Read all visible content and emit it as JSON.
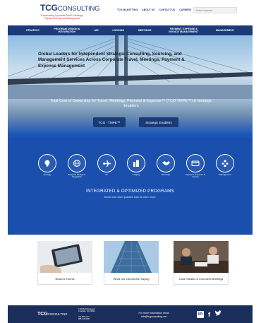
{
  "header": {
    "logo_main": "TCG",
    "logo_consult": "CONSULTING",
    "logo_tagline": "Transforming Corporate Travel, Meetings, Payment & Expense Management",
    "topnav": [
      "TCG MAKETTING",
      "ABOUT US",
      "CONTACT US",
      "CAREERS"
    ],
    "search_placeholder": "Enter Keyword"
  },
  "mainnav": [
    "STRATEGY",
    "PROGRAM DESIGN & INTEGRATION",
    "AIR",
    "LODGING",
    "MEETINGS",
    "PAYMENT, EXPENSE & INVOICE MANAGEMENT",
    "MANAGEMENT"
  ],
  "hero": {
    "title": "Global Leaders for Independent Strategic Consulting, Sourcing, and Management Services Across Corporate Travel, Meetings, Payment & Expense Management",
    "tco_text": "Total Cost of Ownership for Travel, Meetings, Payment & Expense™ (TCO-TMPE™) & Strategic Enablers",
    "btn_tco": "TCO - TMPE™",
    "btn_strategic": "Strategic Enablers",
    "categories": [
      {
        "label": "Strategy",
        "icon": "bulb-icon"
      },
      {
        "label": "Program Design & Integration",
        "icon": "globe-icon"
      },
      {
        "label": "Air",
        "icon": "plane-icon"
      },
      {
        "label": "Lodging",
        "icon": "building-icon"
      },
      {
        "label": "Meetings",
        "icon": "handshake-icon"
      },
      {
        "label": "Payment, Expense & Invoice",
        "icon": "card-icon"
      },
      {
        "label": "Management",
        "icon": "people-icon"
      }
    ],
    "programs_title": "INTEGRATED & OPTIMIZED PROGRAMS",
    "programs_sub": "Scroll over each practice icon to learn more."
  },
  "cards": [
    {
      "label": "News & Events"
    },
    {
      "label": "What Our Clients Are Saying"
    },
    {
      "label": "Case Studies & Executive Briefings"
    }
  ],
  "footer": {
    "logo_main": "TCG",
    "logo_consult": "CONSULTING",
    "address_1": "1700 Bull Boulevard",
    "address_2": "Charlotte, NC 28203",
    "phone_1": "704.851.2277",
    "phone_2": "888.415.0285",
    "contact_line": "For more information email",
    "email": "info@tcgconsulting.net",
    "social": [
      "in",
      "f",
      "t"
    ]
  },
  "colors": {
    "navy": "#1b3a7a",
    "hero_blue": "#1a4fae",
    "footer": "#1a2e5c"
  }
}
